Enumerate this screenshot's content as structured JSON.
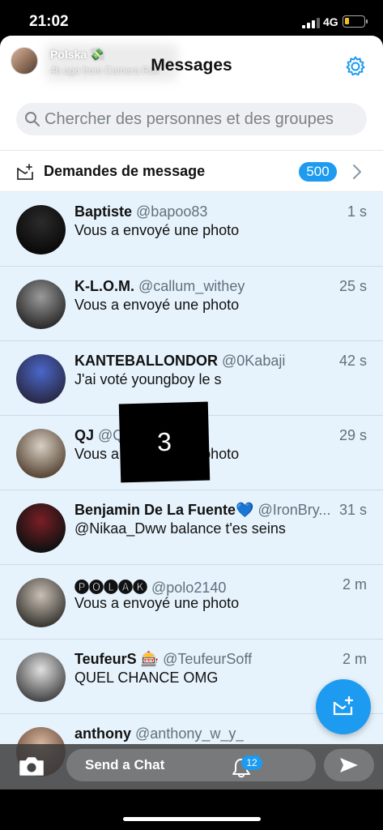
{
  "status_bar": {
    "time": "21:02",
    "network": "4G"
  },
  "story_overlay": {
    "name": "Polska 💸",
    "subtitle": "4h ago from Camera Roll"
  },
  "header": {
    "title": "Messages"
  },
  "search": {
    "placeholder": "Chercher des personnes et des groupes"
  },
  "requests": {
    "label": "Demandes de message",
    "count": "500"
  },
  "conversations": [
    {
      "name": "Baptiste",
      "handle": "@bapoo83",
      "time": "1 s",
      "message": "Vous a envoyé une photo",
      "avatar_colors": [
        "#2b2b2b",
        "#0a0a0a"
      ]
    },
    {
      "name": "K-L.O.M.",
      "handle": "@callum_withey",
      "time": "25 s",
      "message": "Vous a envoyé une photo",
      "avatar_colors": [
        "#9a9a9a",
        "#2d2d2d"
      ]
    },
    {
      "name": "KANTEBALLONDOR",
      "handle": "@0Kabaji",
      "time": "42 s",
      "message": "J'ai voté youngboy le s",
      "avatar_colors": [
        "#4a67c9",
        "#2b2b4a"
      ]
    },
    {
      "name": "QJ",
      "handle": "@Q",
      "time": "29 s",
      "message": "Vous a envoyé une photo",
      "avatar_colors": [
        "#d8d0c4",
        "#5c4a3a"
      ]
    },
    {
      "name": "Benjamin De La Fuente💙",
      "handle": "@IronBry...",
      "time": "31 s",
      "message": "@Nikaa_Dww balance t'es seins",
      "avatar_colors": [
        "#7a1f25",
        "#111111"
      ]
    },
    {
      "name": "🅟🅞🅛🅐🅚",
      "handle": "@polo2140",
      "time": "2 m",
      "message": "Vous a envoyé une photo",
      "avatar_colors": [
        "#c9c1b6",
        "#3d3a35"
      ]
    },
    {
      "name": "TeufeurS 🎰",
      "handle": "@TeufeurSoff",
      "time": "2 m",
      "message": "QUEL CHANCE OMG",
      "avatar_colors": [
        "#e0e0e0",
        "#4b4b4b"
      ]
    },
    {
      "name": "anthony",
      "handle": "@anthony_w_y_",
      "time": "",
      "message": "",
      "avatar_colors": [
        "#d8b8a0",
        "#6b4a3a"
      ]
    }
  ],
  "redaction": {
    "label": "3"
  },
  "snap_bar": {
    "send_label": "Send a Chat",
    "notification_count": "12"
  },
  "colors": {
    "accent": "#1d9bf0",
    "row_bg": "#e7f3fc"
  }
}
